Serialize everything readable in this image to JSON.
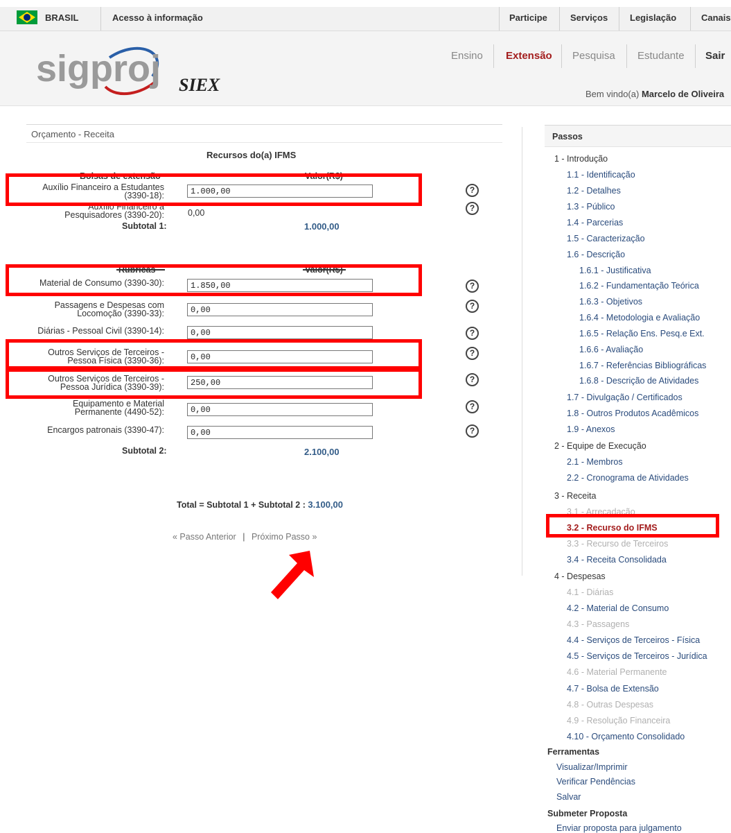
{
  "gov_bar": {
    "brasil": "BRASIL",
    "acesso": "Acesso à informação",
    "links": [
      "Participe",
      "Serviços",
      "Legislação",
      "Canais"
    ]
  },
  "header": {
    "logo_text": "sigproj",
    "logo2_text": "SIEX",
    "nav": [
      "Ensino",
      "Extensão",
      "Pesquisa",
      "Estudante",
      "Sair"
    ],
    "welcome_prefix": "Bem vindo(a)",
    "user_name": "Marcelo de Oliveira"
  },
  "form": {
    "section_title": "Orçamento - Receita",
    "resources_title": "Recursos do(a) IFMS",
    "bolsas_header": "Bolsas de extensão",
    "valor_header": "Valor(R$)",
    "bolsas": [
      {
        "label": "Auxílio Financeiro a Estudantes (3390-18):",
        "value": "1.000,00"
      },
      {
        "label": "Auxílio Financeiro a Pesquisadores (3390-20):",
        "value": "0,00"
      }
    ],
    "subtotal1_label": "Subtotal 1:",
    "subtotal1_value": "1.000,00",
    "rubricas_header": "Rubricas",
    "valor_header2": "Valor(R$)",
    "rubricas": [
      {
        "label": "Material de Consumo (3390-30):",
        "value": "1.850,00"
      },
      {
        "label": "Passagens e Despesas com Locomoção (3390-33):",
        "value": "0,00"
      },
      {
        "label": "Diárias - Pessoal Civil (3390-14):",
        "value": "0,00"
      },
      {
        "label": "Outros Serviços de Terceiros - Pessoa Física (3390-36):",
        "value": "0,00"
      },
      {
        "label": "Outros Serviços de Terceiros - Pessoa Jurídica (3390-39):",
        "value": "250,00"
      },
      {
        "label": "Equipamento e Material Permanente (4490-52):",
        "value": "0,00"
      },
      {
        "label": "Encargos patronais (3390-47):",
        "value": "0,00"
      }
    ],
    "subtotal2_label": "Subtotal 2:",
    "subtotal2_value": "2.100,00",
    "total_label": "Total = Subtotal 1 + Subtotal 2 :",
    "total_value": "3.100,00",
    "prev_step": "« Passo Anterior",
    "separator": "|",
    "next_step": "Próximo Passo »",
    "help_glyph": "?"
  },
  "sidebar": {
    "title": "Passos",
    "items": [
      {
        "text": "1 - Introdução",
        "kind": "grp"
      },
      {
        "text": "1.1 - Identificação",
        "kind": "link"
      },
      {
        "text": "1.2 - Detalhes",
        "kind": "link"
      },
      {
        "text": "1.3 - Público",
        "kind": "link"
      },
      {
        "text": "1.4 - Parcerias",
        "kind": "link"
      },
      {
        "text": "1.5 - Caracterização",
        "kind": "link"
      },
      {
        "text": "1.6 - Descrição",
        "kind": "link"
      },
      {
        "text": "1.6.1 - Justificativa",
        "kind": "sub"
      },
      {
        "text": "1.6.2 - Fundamentação Teórica",
        "kind": "sub"
      },
      {
        "text": "1.6.3 - Objetivos",
        "kind": "sub"
      },
      {
        "text": "1.6.4 - Metodologia e Avaliação",
        "kind": "sub"
      },
      {
        "text": "1.6.5 - Relação Ens. Pesq.e Ext.",
        "kind": "sub"
      },
      {
        "text": "1.6.6 - Avaliação",
        "kind": "sub"
      },
      {
        "text": "1.6.7 - Referências Bibliográficas",
        "kind": "sub"
      },
      {
        "text": "1.6.8 - Descrição de Atividades",
        "kind": "sub"
      },
      {
        "text": "1.7 - Divulgação / Certificados",
        "kind": "link"
      },
      {
        "text": "1.8 - Outros Produtos Acadêmicos",
        "kind": "link"
      },
      {
        "text": "1.9 - Anexos",
        "kind": "link"
      },
      {
        "text": "2 - Equipe de Execução",
        "kind": "grp"
      },
      {
        "text": "2.1 - Membros",
        "kind": "link"
      },
      {
        "text": "2.2 - Cronograma de Atividades",
        "kind": "link"
      },
      {
        "text": "3 - Receita",
        "kind": "grp"
      },
      {
        "text": "3.1 - Arrecadação",
        "kind": "dis"
      },
      {
        "text": "3.2 - Recurso do IFMS",
        "kind": "cur"
      },
      {
        "text": "3.3 - Recurso de Terceiros",
        "kind": "dis"
      },
      {
        "text": "3.4 - Receita Consolidada",
        "kind": "link"
      },
      {
        "text": "4 - Despesas",
        "kind": "grp"
      },
      {
        "text": "4.1 - Diárias",
        "kind": "dis"
      },
      {
        "text": "4.2 - Material de Consumo",
        "kind": "link"
      },
      {
        "text": "4.3 - Passagens",
        "kind": "dis"
      },
      {
        "text": "4.4 - Serviços de Terceiros - Física",
        "kind": "link"
      },
      {
        "text": "4.5 - Serviços de Terceiros - Jurídica",
        "kind": "link"
      },
      {
        "text": "4.6 - Material Permanente",
        "kind": "dis"
      },
      {
        "text": "4.7 - Bolsa de Extensão",
        "kind": "link"
      },
      {
        "text": "4.8 - Outras Despesas",
        "kind": "dis"
      },
      {
        "text": "4.9 - Resolução Financeira",
        "kind": "dis"
      },
      {
        "text": "4.10 - Orçamento Consolidado",
        "kind": "link"
      }
    ],
    "tools_title": "Ferramentas",
    "tools": [
      "Visualizar/Imprimir",
      "Verificar Pendências",
      "Salvar"
    ],
    "submit_title": "Submeter Proposta",
    "submit_link": "Enviar proposta para julgamento"
  }
}
